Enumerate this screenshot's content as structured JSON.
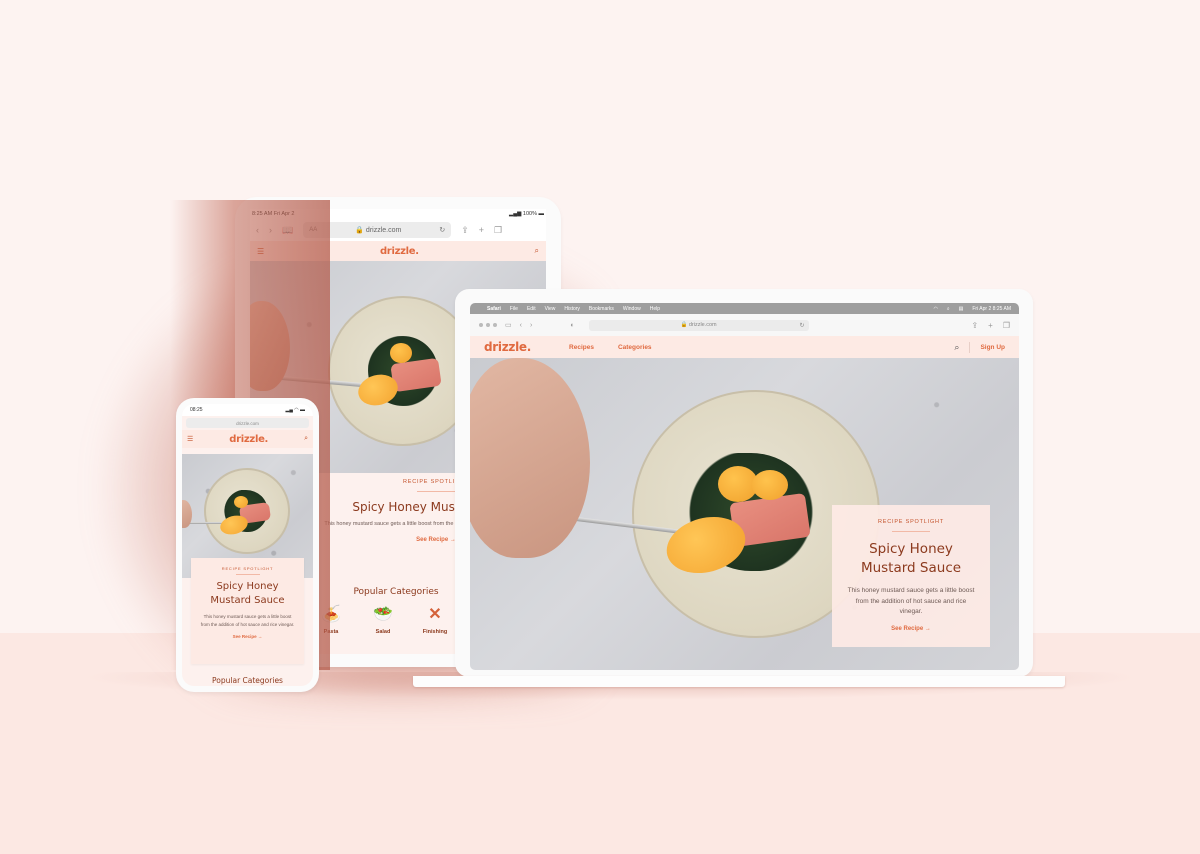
{
  "scene": {
    "colors": {
      "background": "#fdf3f1",
      "floor": "#fce8e3",
      "brand_accent": "#e06a40",
      "title_color": "#8c3a1e",
      "nav_background": "#fdeae4"
    }
  },
  "site": {
    "logo": "drizzle.",
    "nav_links": [
      "Recipes",
      "Categories"
    ],
    "signup_label": "Sign Up",
    "spotlight": {
      "eyebrow": "RECIPE SPOTLIGHT",
      "title": "Spicy Honey Mustard Sauce",
      "title_line1": "Spicy Honey",
      "title_line2": "Mustard Sauce",
      "description": "This honey mustard sauce gets a little boost from the addition of hot sauce and rice vinegar.",
      "link_label": "See Recipe →"
    },
    "popular_categories": {
      "title": "Popular Categories",
      "items": [
        {
          "label": "Pasta",
          "icon": "pasta-icon"
        },
        {
          "label": "Salad",
          "icon": "salad-icon"
        },
        {
          "label": "Finishing",
          "icon": "spoons-icon"
        }
      ]
    }
  },
  "laptop": {
    "menubar": {
      "app": "Safari",
      "items": [
        "File",
        "Edit",
        "View",
        "History",
        "Bookmarks",
        "Window",
        "Help"
      ],
      "clock": "Fri Apr 2  8:25 AM"
    },
    "url": "drizzle.com"
  },
  "tablet": {
    "status_time": "8:25 AM  Fri Apr 2",
    "status_battery": "100%",
    "url": "drizzle.com",
    "text_size_label": "AA"
  },
  "phone": {
    "status_time": "08:25",
    "url": "drizzle.com"
  }
}
